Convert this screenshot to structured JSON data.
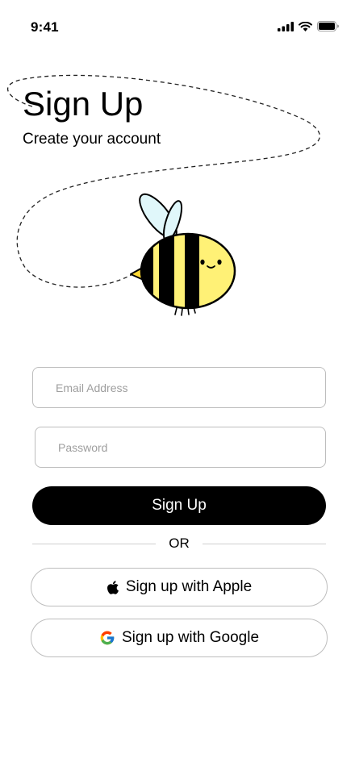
{
  "status_bar": {
    "time": "9:41"
  },
  "header": {
    "title": "Sign Up",
    "subtitle": "Create your account"
  },
  "form": {
    "email_placeholder": "Email Address",
    "password_placeholder": "Password",
    "submit_label": "Sign Up"
  },
  "divider_label": "OR",
  "social": {
    "apple_label": "Sign up with Apple",
    "google_label": "Sign up with Google"
  },
  "colors": {
    "primary": "#000000",
    "bee_yellow": "#fff176",
    "bee_wing": "#e0f7fa",
    "field_border": "#bdbdbd"
  },
  "icons": [
    "signal-icon",
    "wifi-icon",
    "battery-icon",
    "bee-illustration",
    "apple-icon",
    "google-icon"
  ]
}
